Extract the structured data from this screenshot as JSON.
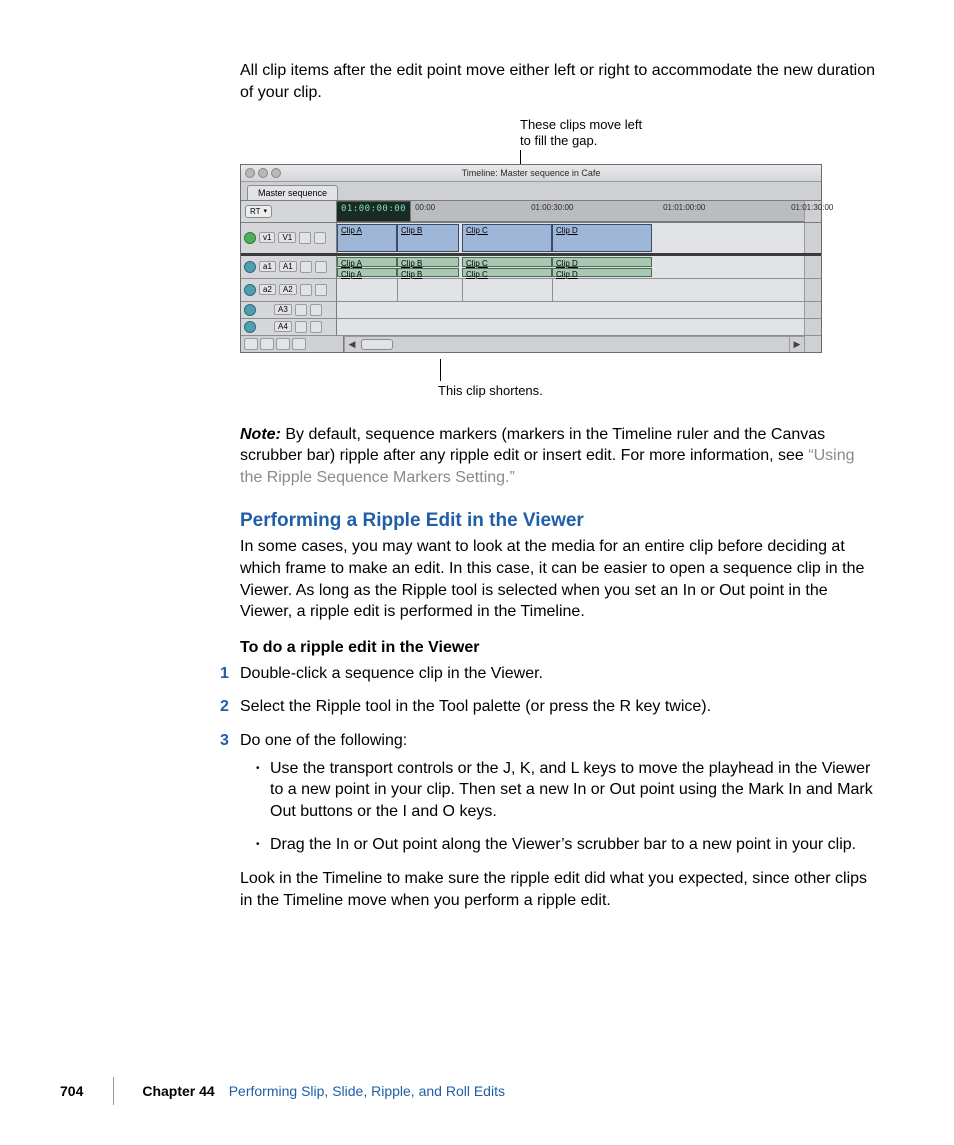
{
  "intro": "All clip items after the edit point move either left or right to accommodate the new duration of your clip.",
  "callout_top": "These clips move left to fill the gap.",
  "callout_bottom": "This clip shortens.",
  "figure": {
    "window_title": "Timeline: Master sequence in Cafe",
    "tab": "Master sequence",
    "rt_label": "RT",
    "timecode": "01:00:00:00",
    "ruler_ticks": [
      "00:00",
      "01:00:30:00",
      "01:01:00:00",
      "01:01:30:00"
    ],
    "video_track": {
      "label_a": "v1",
      "label_b": "V1",
      "clips": [
        "Clip A",
        "Clip B",
        "Clip C",
        "Clip D"
      ]
    },
    "audio1": {
      "label_a": "a1",
      "label_b": "A1",
      "clips": [
        "Clip A",
        "Clip B",
        "Clip C",
        "Clip D"
      ],
      "clips2": [
        "Clip A",
        "Clip B",
        "Clip C",
        "Clip D"
      ]
    },
    "audio2": {
      "label_a": "a2",
      "label_b": "A2"
    },
    "audio3": {
      "label": "A3"
    },
    "audio4": {
      "label": "A4"
    }
  },
  "note": {
    "label": "Note:",
    "body": "By default, sequence markers (markers in the Timeline ruler and the Canvas scrubber bar) ripple after any ripple edit or insert edit.  For more information, see ",
    "link": "“Using the Ripple Sequence Markers Setting.”"
  },
  "section_heading": "Performing a Ripple Edit in the Viewer",
  "section_body": "In some cases, you may want to look at the media for an entire clip before deciding at which frame to make an edit. In this case, it can be easier to open a sequence clip in the Viewer. As long as the Ripple tool is selected when you set an In or Out point in the Viewer, a ripple edit is performed in the Timeline.",
  "task_heading": "To do a ripple edit in the Viewer",
  "step1": "Double-click a sequence clip in the Viewer.",
  "step2": "Select the Ripple tool in the Tool palette (or press the R key twice).",
  "step3": "Do one of the following:",
  "bullet1": "Use the transport controls or the J, K, and L keys to move the playhead in the Viewer to a new point in your clip. Then set a new In or Out point using the Mark In and Mark Out buttons or the I and O keys.",
  "bullet2": "Drag the In or Out point along the Viewer’s scrubber bar to a new point in your clip.",
  "closing": "Look in the Timeline to make sure the ripple edit did what you expected, since other clips in the Timeline move when you perform a ripple edit.",
  "footer": {
    "page": "704",
    "chapter_label": "Chapter 44",
    "chapter_title": "Performing Slip, Slide, Ripple, and Roll Edits"
  }
}
